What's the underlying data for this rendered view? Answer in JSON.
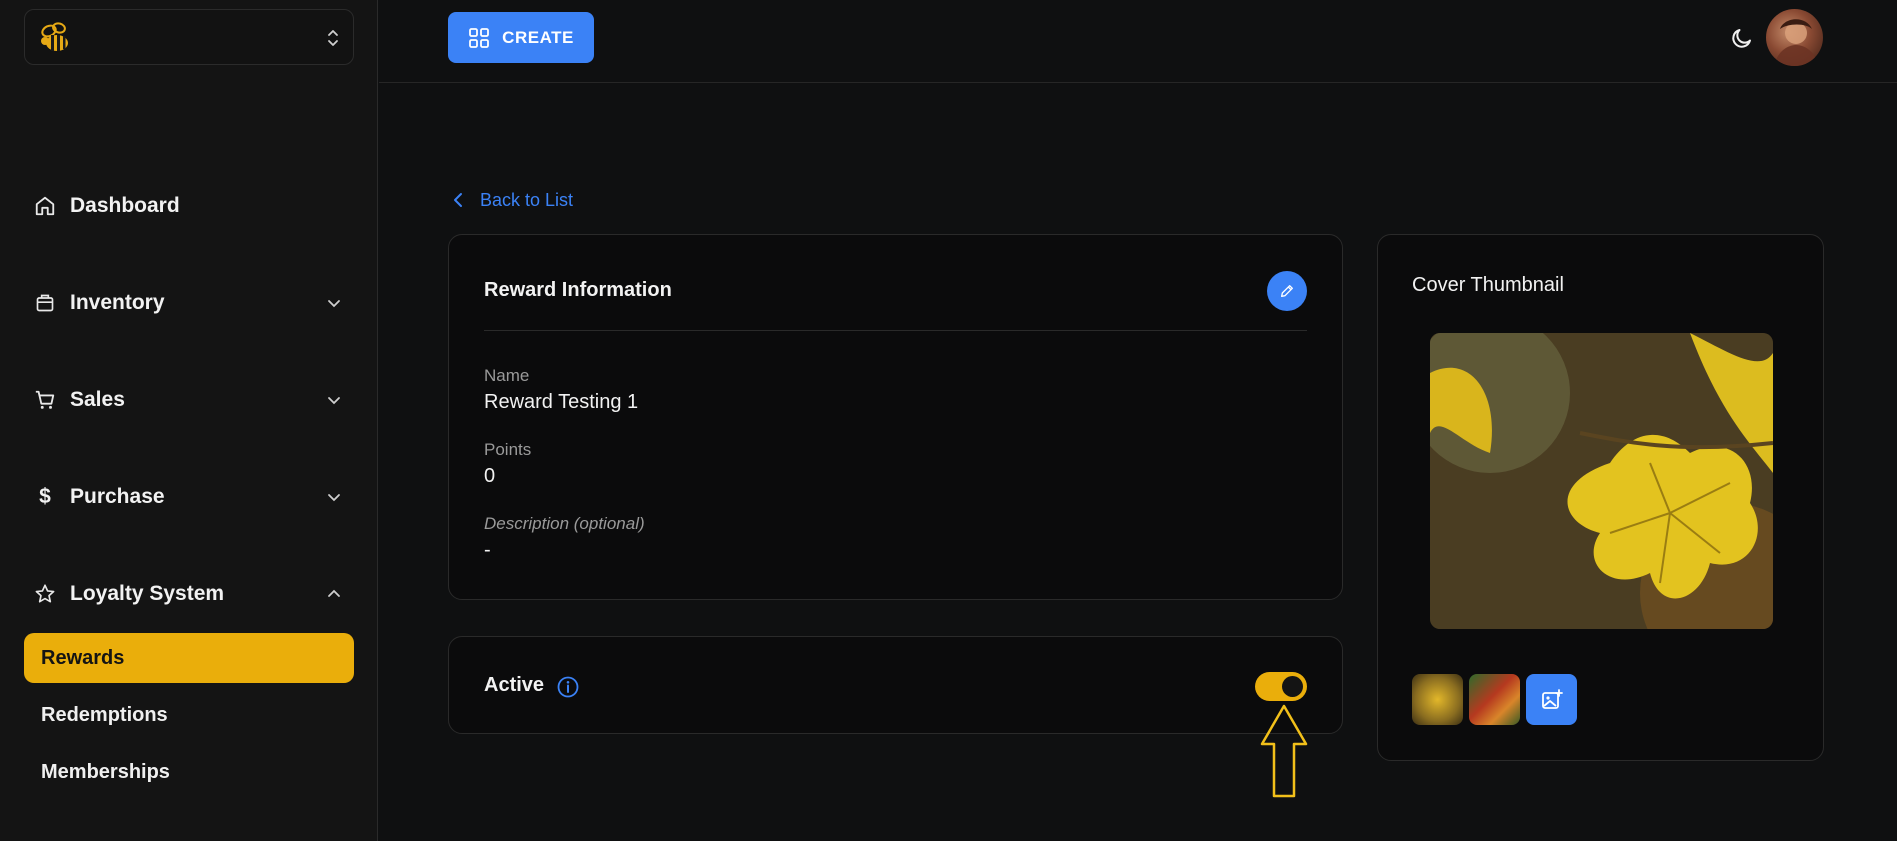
{
  "sidebar": {
    "items": [
      {
        "label": "Dashboard",
        "icon": "home-icon"
      },
      {
        "label": "Inventory",
        "icon": "box-icon"
      },
      {
        "label": "Sales",
        "icon": "cart-icon"
      },
      {
        "label": "Purchase",
        "icon": "dollar-icon"
      },
      {
        "label": "Loyalty System",
        "icon": "star-icon"
      }
    ],
    "loyalty_sub": [
      {
        "label": "Rewards",
        "active": true
      },
      {
        "label": "Redemptions",
        "active": false
      },
      {
        "label": "Memberships",
        "active": false
      }
    ]
  },
  "header": {
    "create_label": "CREATE"
  },
  "main": {
    "back_label": "Back to List",
    "info": {
      "title": "Reward Information",
      "name_label": "Name",
      "name_value": "Reward Testing 1",
      "points_label": "Points",
      "points_value": "0",
      "description_label": "Description (optional)",
      "description_value": "-"
    },
    "active": {
      "label": "Active",
      "enabled": true
    },
    "thumbnail": {
      "title": "Cover Thumbnail"
    }
  },
  "colors": {
    "accent": "#3b82f6",
    "highlight": "#eaae0b",
    "background": "#0f1011"
  }
}
